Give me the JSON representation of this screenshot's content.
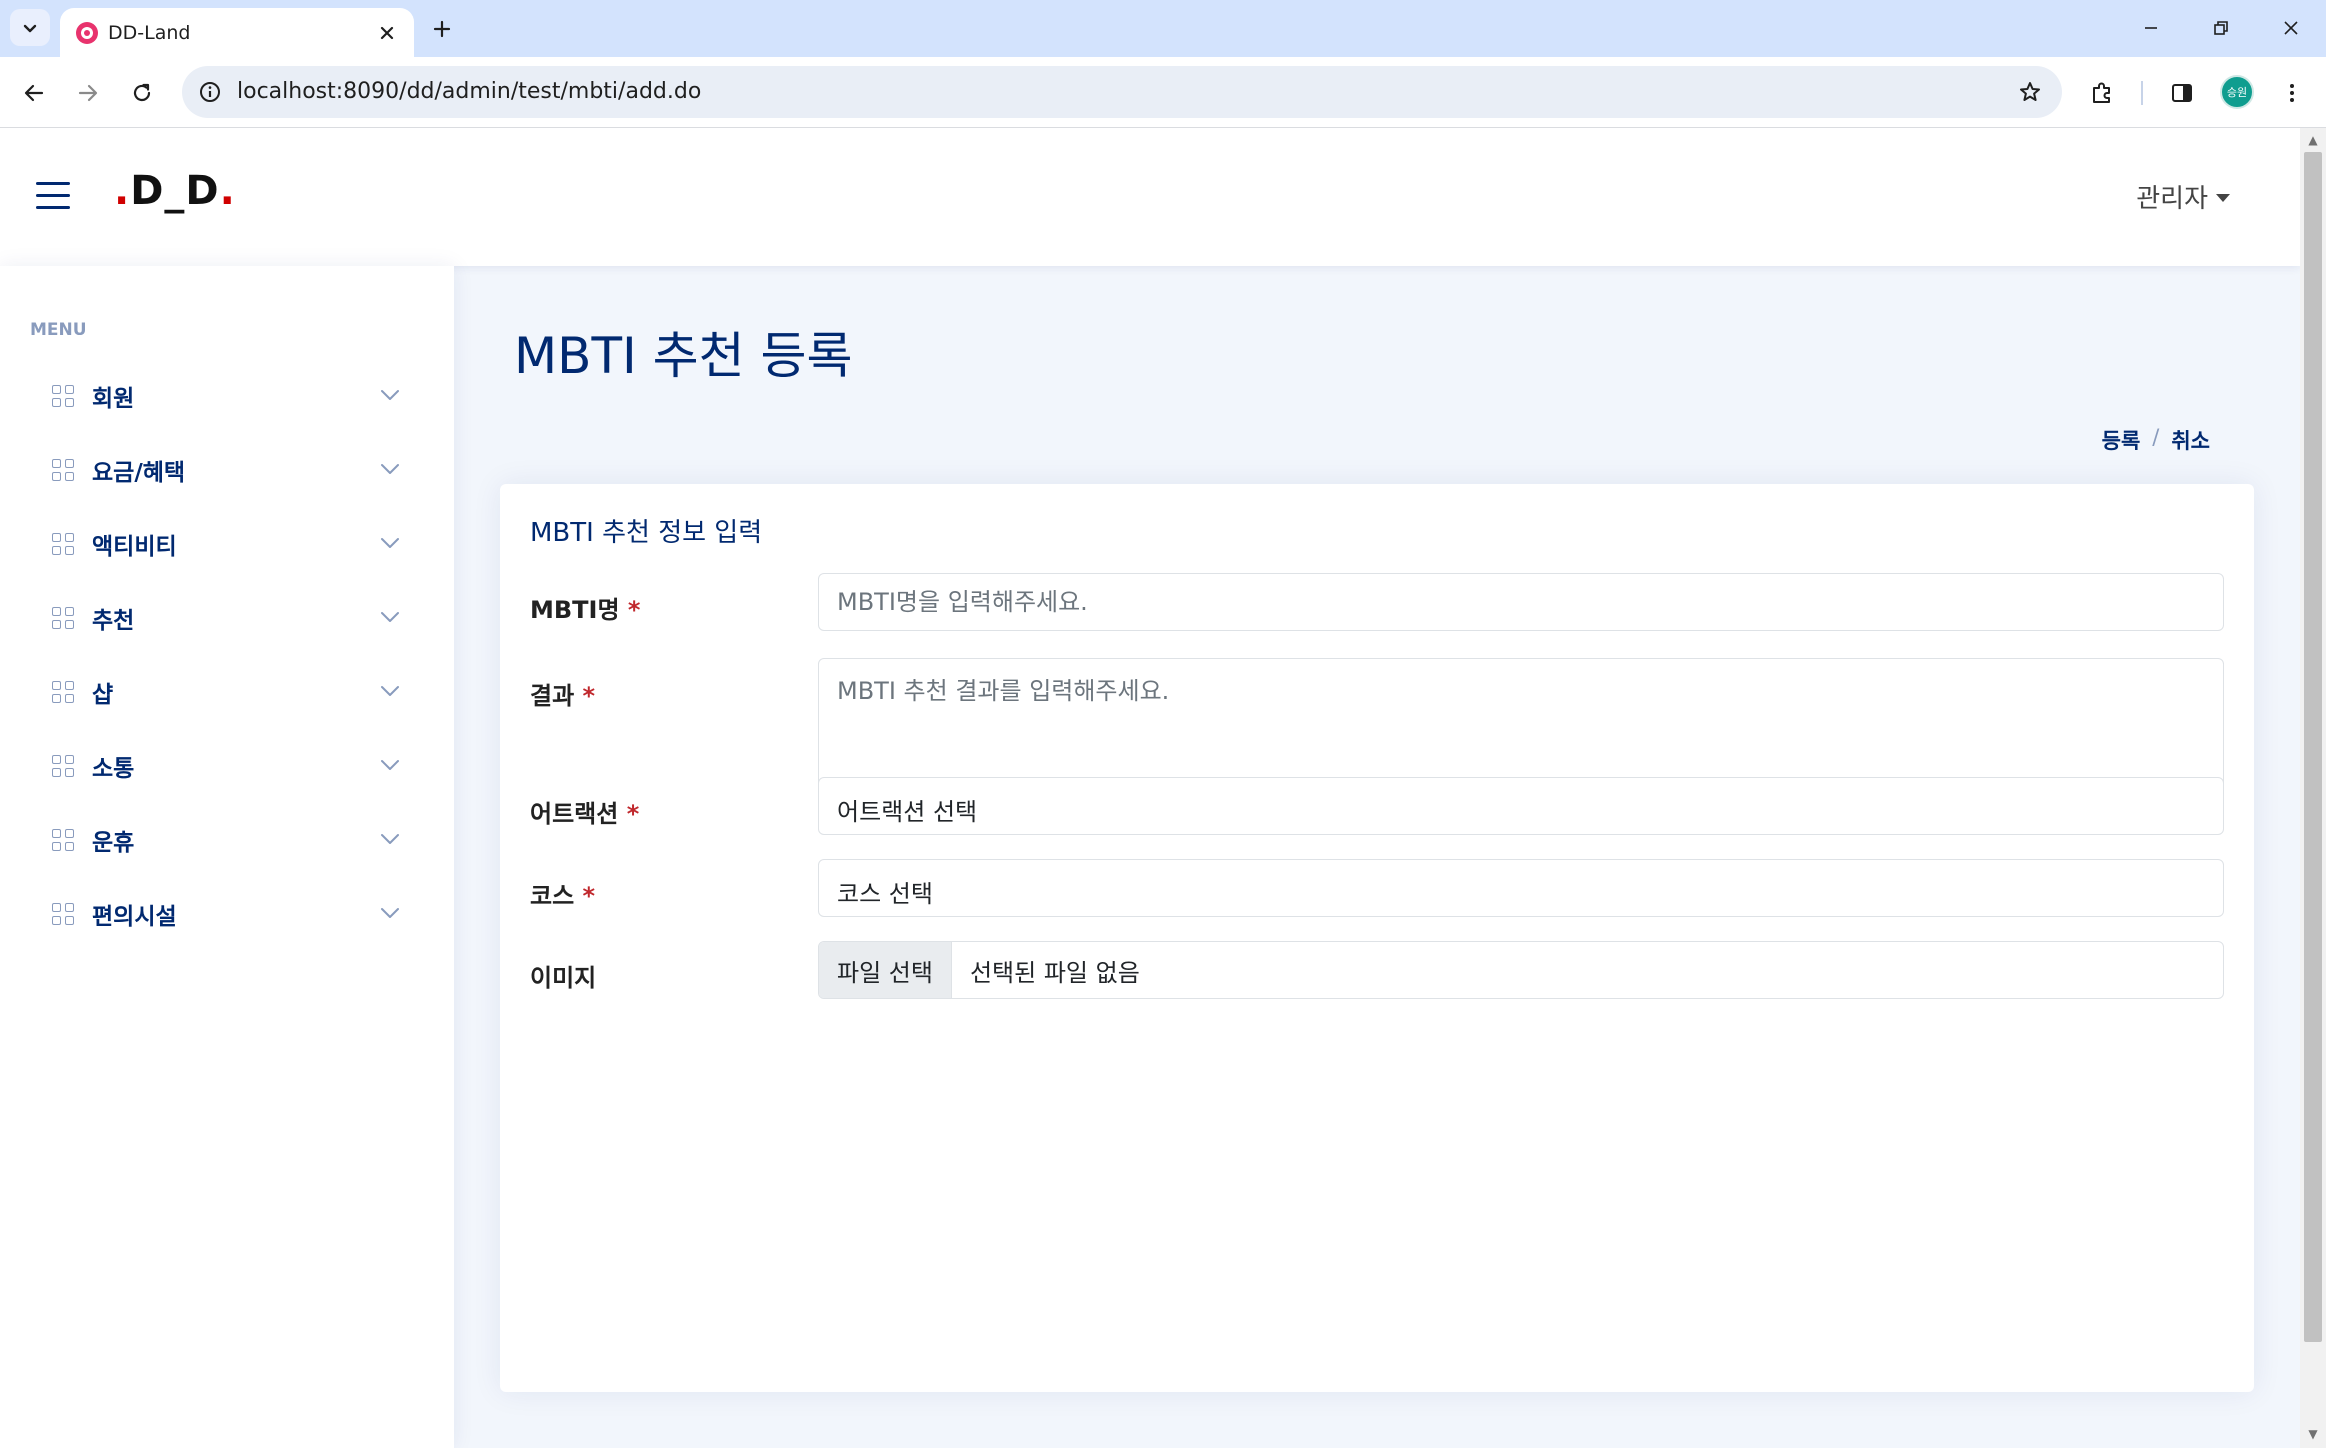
{
  "browser": {
    "tab_title": "DD-Land",
    "url": "localhost:8090/dd/admin/test/mbti/add.do",
    "profile_label": "승원",
    "accent": "#d3e3fd"
  },
  "header": {
    "logo": {
      "dot1": ".",
      "text": "D_D",
      "dot2": "."
    },
    "admin_label": "관리자",
    "brand_color": "#012970"
  },
  "sidebar": {
    "heading": "MENU",
    "items": [
      {
        "label": "회원"
      },
      {
        "label": "요금/혜택"
      },
      {
        "label": "액티비티"
      },
      {
        "label": "추천"
      },
      {
        "label": "샵"
      },
      {
        "label": "소통"
      },
      {
        "label": "운휴"
      },
      {
        "label": "편의시설"
      }
    ]
  },
  "main": {
    "page_title": "MBTI 추천 등록",
    "breadcrumb": {
      "register": "등록",
      "separator": "/",
      "cancel": "취소"
    },
    "card_title": "MBTI 추천 정보 입력",
    "form": {
      "mbti_name": {
        "label": "MBTI명",
        "required": "*",
        "placeholder": "MBTI명을 입력해주세요.",
        "value": ""
      },
      "result": {
        "label": "결과",
        "required": "*",
        "placeholder": "MBTI 추천 결과를 입력해주세요.",
        "value": ""
      },
      "attraction": {
        "label": "어트랙션",
        "required": "*",
        "selected": "어트랙션 선택"
      },
      "course": {
        "label": "코스",
        "required": "*",
        "selected": "코스 선택"
      },
      "image": {
        "label": "이미지",
        "button": "파일 선택",
        "status": "선택된 파일 없음"
      }
    },
    "required_color": "#c0282d"
  }
}
